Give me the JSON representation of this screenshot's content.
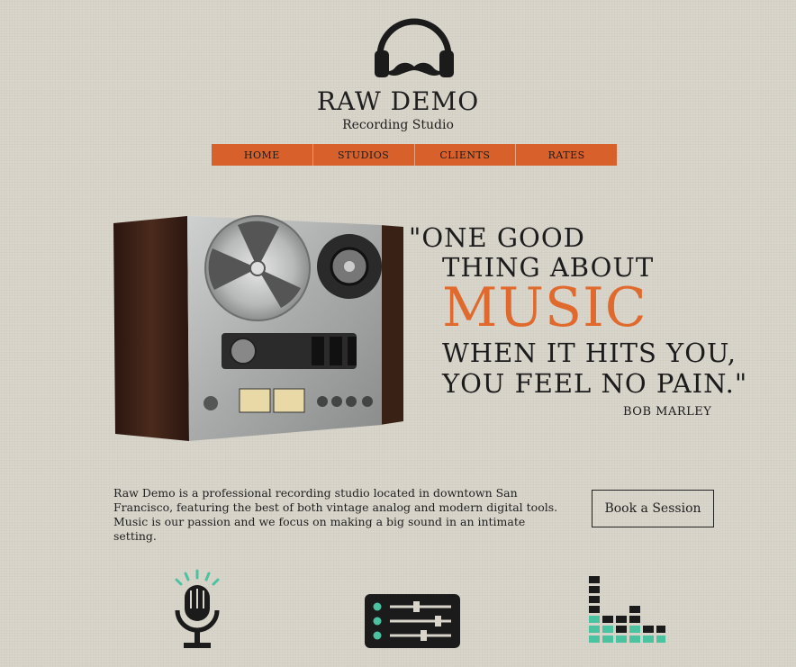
{
  "header": {
    "logo_icon": "headphones-mustache-icon",
    "brand": "RAW DEMO",
    "tagline": "Recording Studio"
  },
  "nav": {
    "items": [
      {
        "label": "HOME"
      },
      {
        "label": "STUDIOS"
      },
      {
        "label": "CLIENTS"
      },
      {
        "label": "RATES"
      }
    ]
  },
  "hero": {
    "image": "reel-to-reel-tape-recorder",
    "quote": {
      "line1": "\"ONE GOOD",
      "line2": "THING ABOUT",
      "line3": "MUSIC",
      "line4": "WHEN IT HITS YOU,",
      "line5": "YOU FEEL NO PAIN.\"",
      "author": "BOB MARLEY"
    }
  },
  "about": {
    "text": "Raw Demo is a professional recording studio located in downtown San Francisco, featuring the best of both vintage analog and modern digital tools. Music is our passion and we focus on making a big sound in an intimate setting.",
    "cta": "Book a Session"
  },
  "features": {
    "icons": [
      "microphone-icon",
      "mixer-sliders-icon",
      "equalizer-bars-icon"
    ]
  },
  "colors": {
    "background": "#d9d5cb",
    "accent": "#d8602a",
    "quote_highlight": "#e06a2e",
    "teal": "#4cc3a0",
    "text": "#1c1c1c"
  }
}
